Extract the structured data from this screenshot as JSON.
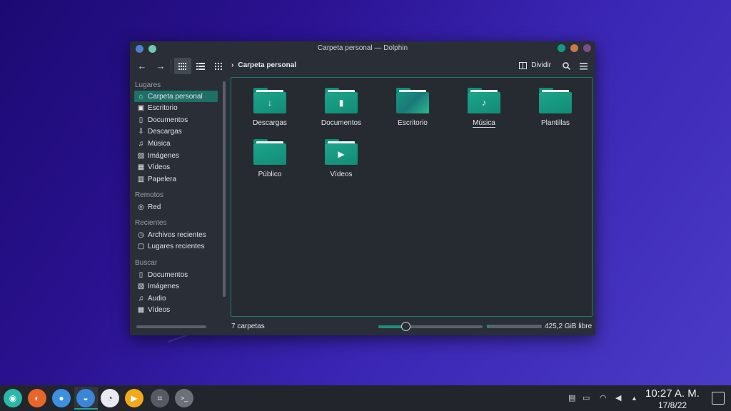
{
  "window": {
    "title": "Carpeta personal — Dolphin",
    "buttons": {
      "left": [
        "#4a7fd0",
        "#6fc7b8"
      ],
      "right": [
        "#129a88",
        "#c97a4a",
        "#7a4e86"
      ]
    }
  },
  "toolbar": {
    "back_icon": "arrow-left-icon",
    "forward_icon": "arrow-right-icon",
    "view_modes": [
      "icons-view",
      "compact-view",
      "details-view"
    ],
    "breadcrumb": "Carpeta personal",
    "split_label": "Dividir",
    "search_icon": "search-icon",
    "menu_icon": "hamburger-menu-icon"
  },
  "sidebar": {
    "places_header": "Lugares",
    "places": [
      {
        "label": "Carpeta personal",
        "icon": "home-icon"
      },
      {
        "label": "Escritorio",
        "icon": "desktop-icon"
      },
      {
        "label": "Documentos",
        "icon": "document-icon"
      },
      {
        "label": "Descargas",
        "icon": "download-icon"
      },
      {
        "label": "Música",
        "icon": "music-icon"
      },
      {
        "label": "Imágenes",
        "icon": "image-icon"
      },
      {
        "label": "Vídeos",
        "icon": "video-icon"
      },
      {
        "label": "Papelera",
        "icon": "trash-icon"
      }
    ],
    "remote_header": "Remotos",
    "remote": [
      {
        "label": "Red",
        "icon": "network-icon"
      }
    ],
    "recent_header": "Recientes",
    "recent": [
      {
        "label": "Archivos recientes",
        "icon": "clock-icon"
      },
      {
        "label": "Lugares recientes",
        "icon": "folder-clock-icon"
      }
    ],
    "search_header": "Buscar",
    "search": [
      {
        "label": "Documentos",
        "icon": "document-icon"
      },
      {
        "label": "Imágenes",
        "icon": "image-icon"
      },
      {
        "label": "Audio",
        "icon": "music-icon"
      },
      {
        "label": "Vídeos",
        "icon": "video-icon"
      }
    ]
  },
  "files": [
    {
      "label": "Descargas",
      "emblem": "↓"
    },
    {
      "label": "Documentos",
      "emblem": "▮"
    },
    {
      "label": "Escritorio",
      "emblem": ""
    },
    {
      "label": "Música",
      "emblem": "♪"
    },
    {
      "label": "Plantillas",
      "emblem": ""
    },
    {
      "label": "Público",
      "emblem": ""
    },
    {
      "label": "Vídeos",
      "emblem": "▶"
    }
  ],
  "status": {
    "count_text": "7 carpetas",
    "zoom_fraction": 0.26,
    "free_fraction": 0.04,
    "free_text": "425,2 GiB libre"
  },
  "taskbar": {
    "apps": [
      {
        "name": "app-launcher-icon",
        "color": "#2ab7a9",
        "glyph": "◉"
      },
      {
        "name": "firefox-icon",
        "color": "#e8652b",
        "glyph": "◐"
      },
      {
        "name": "toggle-app-icon",
        "color": "#3d8fe0",
        "glyph": "●"
      },
      {
        "name": "dolphin-icon",
        "color": "#3a86d8",
        "glyph": "◒"
      },
      {
        "name": "disk-app-icon",
        "color": "#e7eaf0",
        "glyph": "◔"
      },
      {
        "name": "media-player-icon",
        "color": "#f0a81c",
        "glyph": "▶"
      },
      {
        "name": "screenshot-icon",
        "color": "#555a63",
        "glyph": "⌗"
      },
      {
        "name": "terminal-icon",
        "color": "#6b7079",
        "glyph": ">_"
      }
    ],
    "tray_icons": [
      "clipboard-icon",
      "battery-icon",
      "wifi-icon",
      "volume-icon",
      "expand-tray-icon"
    ],
    "time": "10:27 A. M.",
    "date": "17/8/22"
  }
}
